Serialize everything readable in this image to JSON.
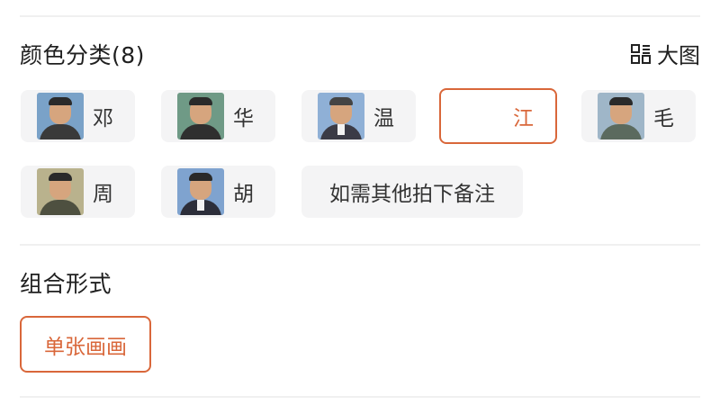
{
  "color_section": {
    "title": "颜色分类(8)",
    "big_view_label": "大图",
    "options": [
      {
        "label": "邓",
        "has_thumb": true,
        "selected": false,
        "bg": "#7aa2c8",
        "suit": "#3a3a3a"
      },
      {
        "label": "华",
        "has_thumb": true,
        "selected": false,
        "bg": "#6f9a86",
        "suit": "#2f2f2f"
      },
      {
        "label": "温",
        "has_thumb": true,
        "selected": false,
        "bg": "#8fb0d6",
        "suit": "#3b3b46"
      },
      {
        "label": "江",
        "has_thumb": false,
        "selected": true
      },
      {
        "label": "毛",
        "has_thumb": true,
        "selected": false,
        "bg": "#9fb6c8",
        "suit": "#5b6a5e"
      },
      {
        "label": "周",
        "has_thumb": true,
        "selected": false,
        "bg": "#b9b28d",
        "suit": "#4e5040"
      },
      {
        "label": "胡",
        "has_thumb": true,
        "selected": false,
        "bg": "#7fa3cf",
        "suit": "#2c2e3a"
      },
      {
        "label": "如需其他拍下备注",
        "has_thumb": false,
        "selected": false
      }
    ]
  },
  "combo_section": {
    "title": "组合形式",
    "options": [
      {
        "label": "单张画画",
        "selected": true
      }
    ]
  },
  "colors": {
    "accent": "#d9673a",
    "chip_bg": "#f4f4f5",
    "divider": "#f0f0f0"
  }
}
